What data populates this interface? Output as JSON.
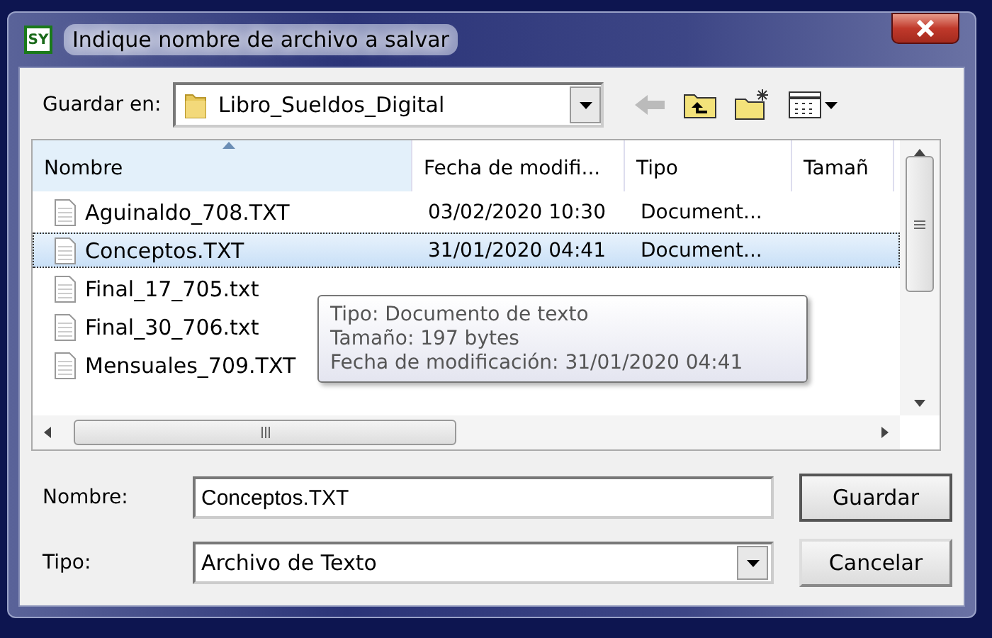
{
  "window": {
    "title": "Indique nombre de archivo a salvar",
    "app_badge": "SY"
  },
  "location": {
    "label": "Guardar en:",
    "value": "Libro_Sueldos_Digital"
  },
  "file_list": {
    "columns": [
      {
        "label": "Nombre",
        "sorted": true
      },
      {
        "label": "Fecha de modifi...",
        "sorted": false
      },
      {
        "label": "Tipo",
        "sorted": false
      },
      {
        "label": "Tamañ",
        "sorted": false
      }
    ],
    "rows": [
      {
        "name": "Aguinaldo_708.TXT",
        "date": "03/02/2020 10:30",
        "type": "Document...",
        "selected": false
      },
      {
        "name": "Conceptos.TXT",
        "date": "31/01/2020 04:41",
        "type": "Document...",
        "selected": true
      },
      {
        "name": "Final_17_705.txt",
        "selected": false
      },
      {
        "name": "Final_30_706.txt",
        "selected": false
      },
      {
        "name": "Mensuales_709.TXT",
        "selected": false
      }
    ]
  },
  "tooltip": {
    "lines": [
      "Tipo: Documento de texto",
      "Tamaño: 197 bytes",
      "Fecha de modificación: 31/01/2020 04:41"
    ]
  },
  "filename": {
    "label": "Nombre:",
    "value": "Conceptos.TXT"
  },
  "filetype": {
    "label": "Tipo:",
    "value": "Archivo de Texto"
  },
  "buttons": [
    "Guardar",
    "Cancelar"
  ]
}
